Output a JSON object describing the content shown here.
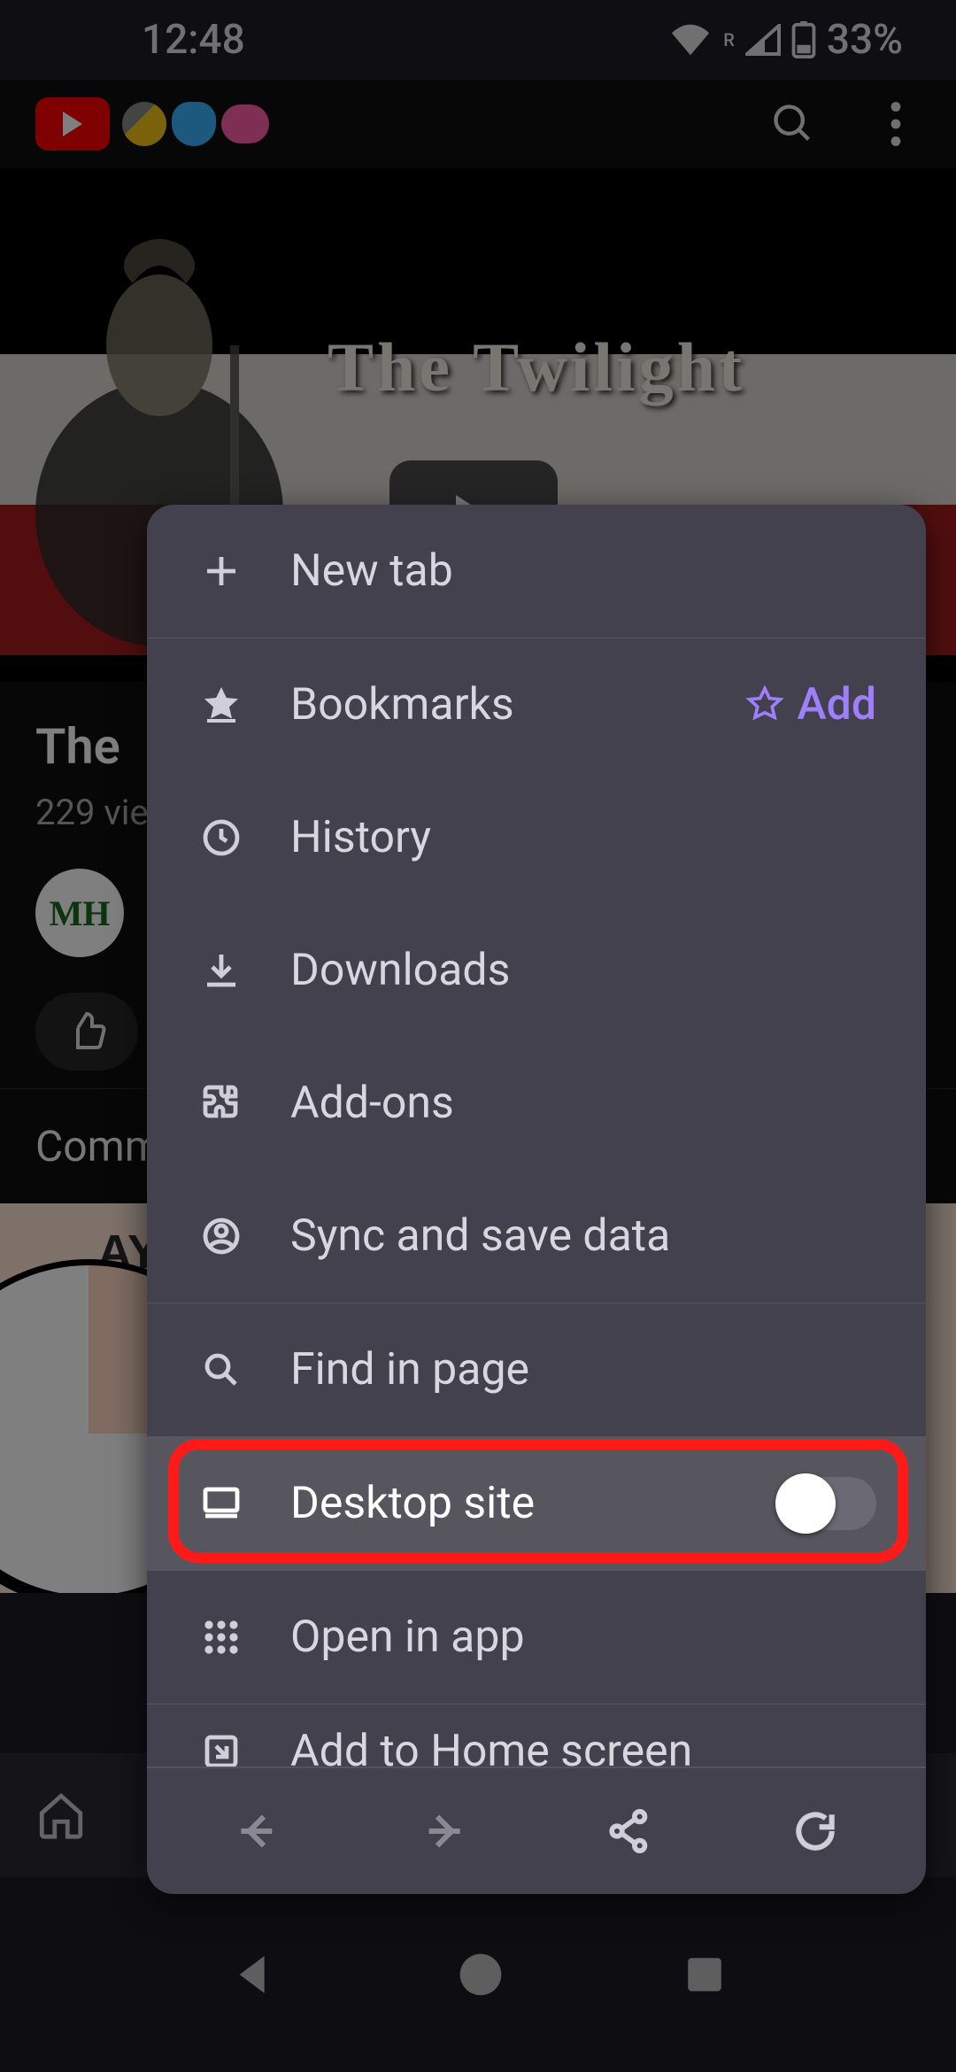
{
  "status": {
    "time": "12:48",
    "battery_text": "33%",
    "signal_badge": "R"
  },
  "yt_header": {
    "search_icon": "search-icon",
    "more_icon": "more-vert-icon"
  },
  "video": {
    "overlay_title": "The Twilight",
    "title_prefix": "The",
    "views_prefix": "229 vie",
    "channel_initials": "MH",
    "comments_label": "Comm",
    "next_card_label_fragment": "AY"
  },
  "menu": {
    "items": [
      {
        "icon": "plus-icon",
        "label": "New tab"
      },
      {
        "icon": "bookmark-icon",
        "label": "Bookmarks",
        "add_label": "Add"
      },
      {
        "icon": "history-icon",
        "label": "History"
      },
      {
        "icon": "download-icon",
        "label": "Downloads"
      },
      {
        "icon": "addon-icon",
        "label": "Add-ons"
      },
      {
        "icon": "account-icon",
        "label": "Sync and save data"
      },
      {
        "icon": "find-icon",
        "label": "Find in page"
      },
      {
        "icon": "desktop-icon",
        "label": "Desktop site",
        "toggle": false
      },
      {
        "icon": "apps-icon",
        "label": "Open in app"
      },
      {
        "icon": "shortcut-icon",
        "label": "Add to Home screen"
      }
    ],
    "bottom": {
      "back": "back-icon",
      "forward": "forward-icon",
      "share": "share-icon",
      "reload": "reload-icon"
    }
  },
  "browser_bottom": {
    "home": "home-icon"
  }
}
